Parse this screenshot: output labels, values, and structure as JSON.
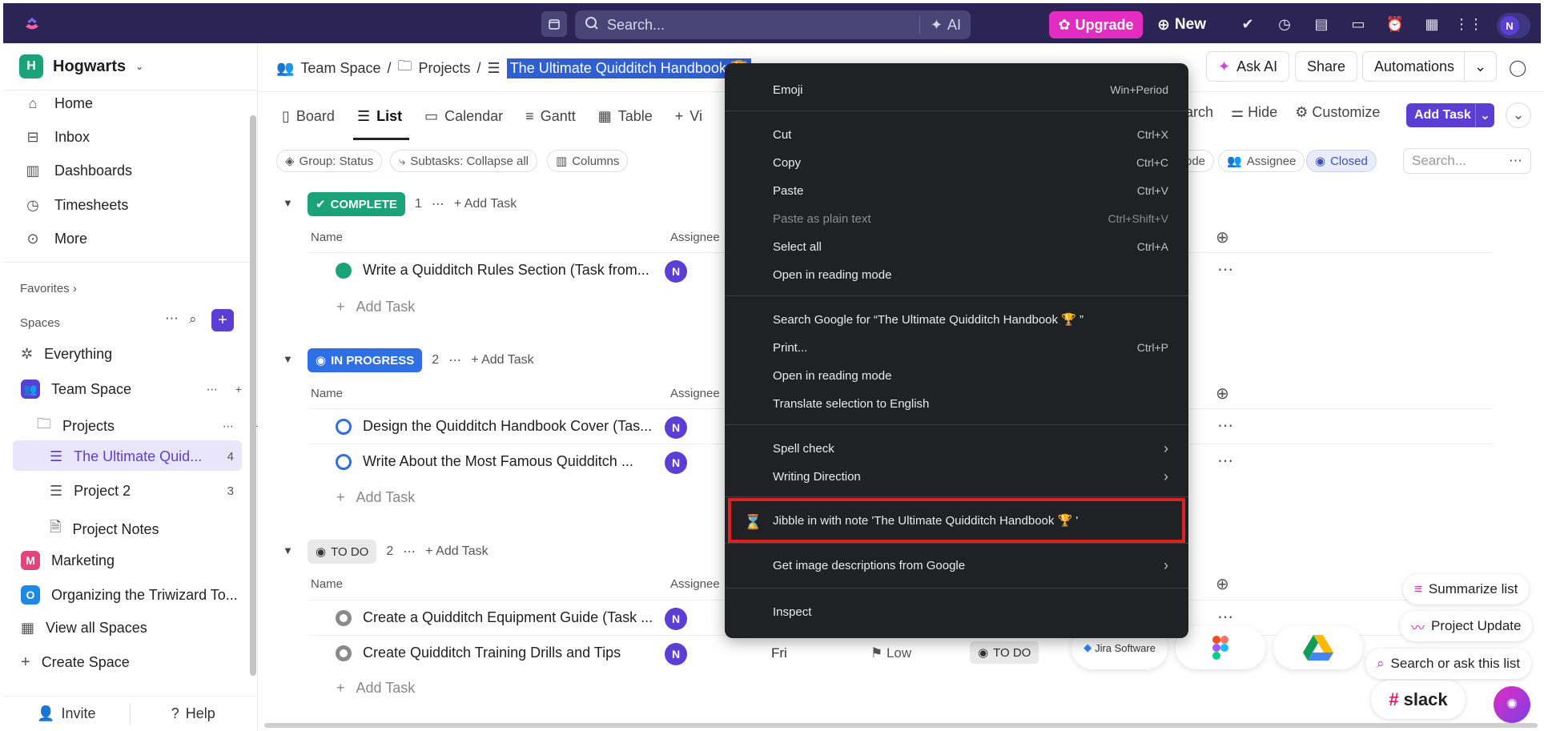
{
  "topbar": {
    "search_placeholder": "Search...",
    "ai_label": "AI",
    "upgrade_label": "Upgrade",
    "new_label": "New",
    "avatar_initial": "N"
  },
  "sidebar": {
    "workspace_initial": "H",
    "workspace_name": "Hogwarts",
    "nav": [
      {
        "label": "Home",
        "icon": "home-icon"
      },
      {
        "label": "Inbox",
        "icon": "inbox-icon"
      },
      {
        "label": "Dashboards",
        "icon": "dashboards-icon"
      },
      {
        "label": "Timesheets",
        "icon": "timesheets-icon"
      },
      {
        "label": "More",
        "icon": "more-icon"
      }
    ],
    "favorites_label": "Favorites",
    "spaces_label": "Spaces",
    "spaces": [
      {
        "label": "Everything"
      },
      {
        "label": "Team Space"
      },
      {
        "label": "Projects"
      },
      {
        "label": "The Ultimate Quid...",
        "count": "4"
      },
      {
        "label": "Project 2",
        "count": "3"
      },
      {
        "label": "Project Notes"
      },
      {
        "label": "Marketing",
        "badge": "M",
        "color": "#e0457b"
      },
      {
        "label": "Organizing the Triwizard To...",
        "badge": "O",
        "color": "#1e88e5"
      },
      {
        "label": "View all Spaces"
      },
      {
        "label": "Create Space"
      }
    ],
    "invite_label": "Invite",
    "help_label": "Help"
  },
  "header": {
    "breadcrumb": [
      "Team Space",
      "Projects",
      "The Ultimate Quidditch Handbook 🏆"
    ],
    "ask_ai_label": "Ask AI",
    "share_label": "Share",
    "automations_label": "Automations"
  },
  "views": {
    "tabs": [
      "Board",
      "List",
      "Calendar",
      "Gantt",
      "Table",
      "Vi"
    ],
    "search_label": "earch",
    "hide_label": "Hide",
    "customize_label": "Customize",
    "add_task_label": "Add Task"
  },
  "filters": {
    "group_label": "Group: Status",
    "subtasks_label": "Subtasks: Collapse all",
    "columns_label": "Columns",
    "mode_label": "ode",
    "assignee_label": "Assignee",
    "closed_label": "Closed",
    "search_placeholder": "Search..."
  },
  "groups": [
    {
      "status": "COMPLETE",
      "color": "#1aa377",
      "count": "1",
      "add_label": "Add Task",
      "name_col": "Name",
      "assignee_col": "Assignee",
      "tasks": [
        {
          "name": "Write a Quidditch Rules Section (Task from...",
          "assignee": "N"
        }
      ]
    },
    {
      "status": "IN PROGRESS",
      "color": "#2f6fe4",
      "count": "2",
      "add_label": "Add Task",
      "name_col": "Name",
      "assignee_col": "Assignee",
      "tasks": [
        {
          "name": "Design the Quidditch Handbook Cover (Tas...",
          "assignee": "N"
        },
        {
          "name": "Write About the Most Famous Quidditch ...",
          "assignee": "N"
        }
      ]
    },
    {
      "status": "TO DO",
      "color": "#e9e9e9",
      "count": "2",
      "add_label": "Add Task",
      "name_col": "Name",
      "assignee_col": "Assignee",
      "tasks": [
        {
          "name": "Create a Quidditch Equipment Guide (Task ...",
          "assignee": "N"
        },
        {
          "name": "Create Quidditch Training Drills and Tips",
          "assignee": "N",
          "due": "Fri",
          "priority": "Low",
          "status": "TO DO"
        }
      ]
    }
  ],
  "add_task_row": "Add Task",
  "context_menu": {
    "items": [
      {
        "label": "Emoji",
        "shortcut": "Win+Period"
      },
      {
        "label": "Cut",
        "shortcut": "Ctrl+X"
      },
      {
        "label": "Copy",
        "shortcut": "Ctrl+C"
      },
      {
        "label": "Paste",
        "shortcut": "Ctrl+V"
      },
      {
        "label": "Paste as plain text",
        "shortcut": "Ctrl+Shift+V",
        "disabled": true
      },
      {
        "label": "Select all",
        "shortcut": "Ctrl+A"
      },
      {
        "label": "Open in reading mode",
        "shortcut": ""
      },
      {
        "label": "Search Google for “The Ultimate Quidditch Handbook 🏆 ”",
        "shortcut": ""
      },
      {
        "label": "Print...",
        "shortcut": "Ctrl+P"
      },
      {
        "label": "Open in reading mode",
        "shortcut": ""
      },
      {
        "label": "Translate selection to English",
        "shortcut": ""
      },
      {
        "label": "Spell check",
        "shortcut": "›"
      },
      {
        "label": "Writing Direction",
        "shortcut": "›"
      },
      {
        "label": "Jibble in with note 'The Ultimate Quidditch Handbook 🏆 '",
        "shortcut": ""
      },
      {
        "label": "Get image descriptions from Google",
        "shortcut": "›"
      },
      {
        "label": "Inspect",
        "shortcut": ""
      }
    ]
  },
  "integrations": {
    "jira_label": "Jira Software",
    "slack_label": "slack"
  },
  "floating": {
    "summarize_label": "Summarize list",
    "project_update_label": "Project Update",
    "search_ask_label": "Search or ask this list"
  }
}
